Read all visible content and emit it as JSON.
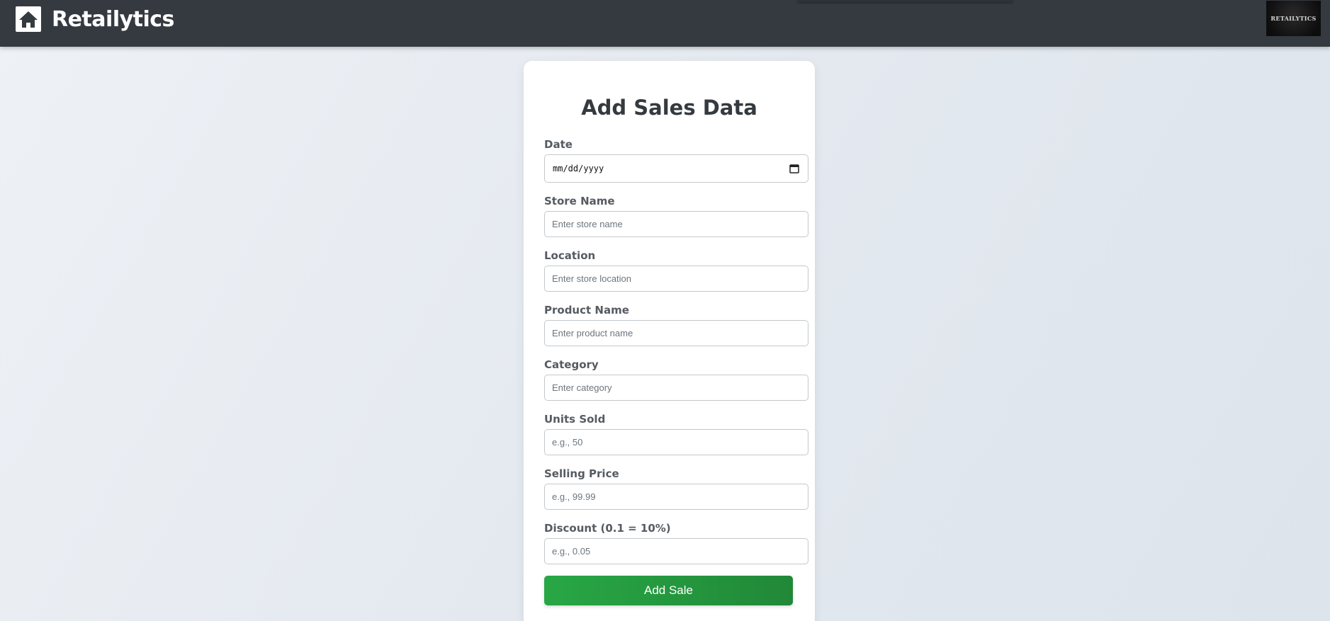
{
  "header": {
    "brand": "Retailytics",
    "home_icon": "home-icon",
    "logo_text": "RETAILYTICS"
  },
  "form": {
    "title": "Add Sales Data",
    "date": {
      "label": "Date",
      "value": "mm/dd/yyyy",
      "icon": "calendar-icon"
    },
    "store_name": {
      "label": "Store Name",
      "placeholder": "Enter store name"
    },
    "location": {
      "label": "Location",
      "placeholder": "Enter store location"
    },
    "product_name": {
      "label": "Product Name",
      "placeholder": "Enter product name"
    },
    "category": {
      "label": "Category",
      "placeholder": "Enter category"
    },
    "units_sold": {
      "label": "Units Sold",
      "placeholder": "e.g., 50"
    },
    "selling_price": {
      "label": "Selling Price",
      "placeholder": "e.g., 99.99"
    },
    "discount": {
      "label": "Discount (0.1 = 10%)",
      "placeholder": "e.g., 0.05"
    },
    "submit_label": "Add Sale"
  },
  "colors": {
    "navbar": "#343a40",
    "accent_green": "#28a745",
    "title_text": "#343a40",
    "card": "#ffffff"
  }
}
